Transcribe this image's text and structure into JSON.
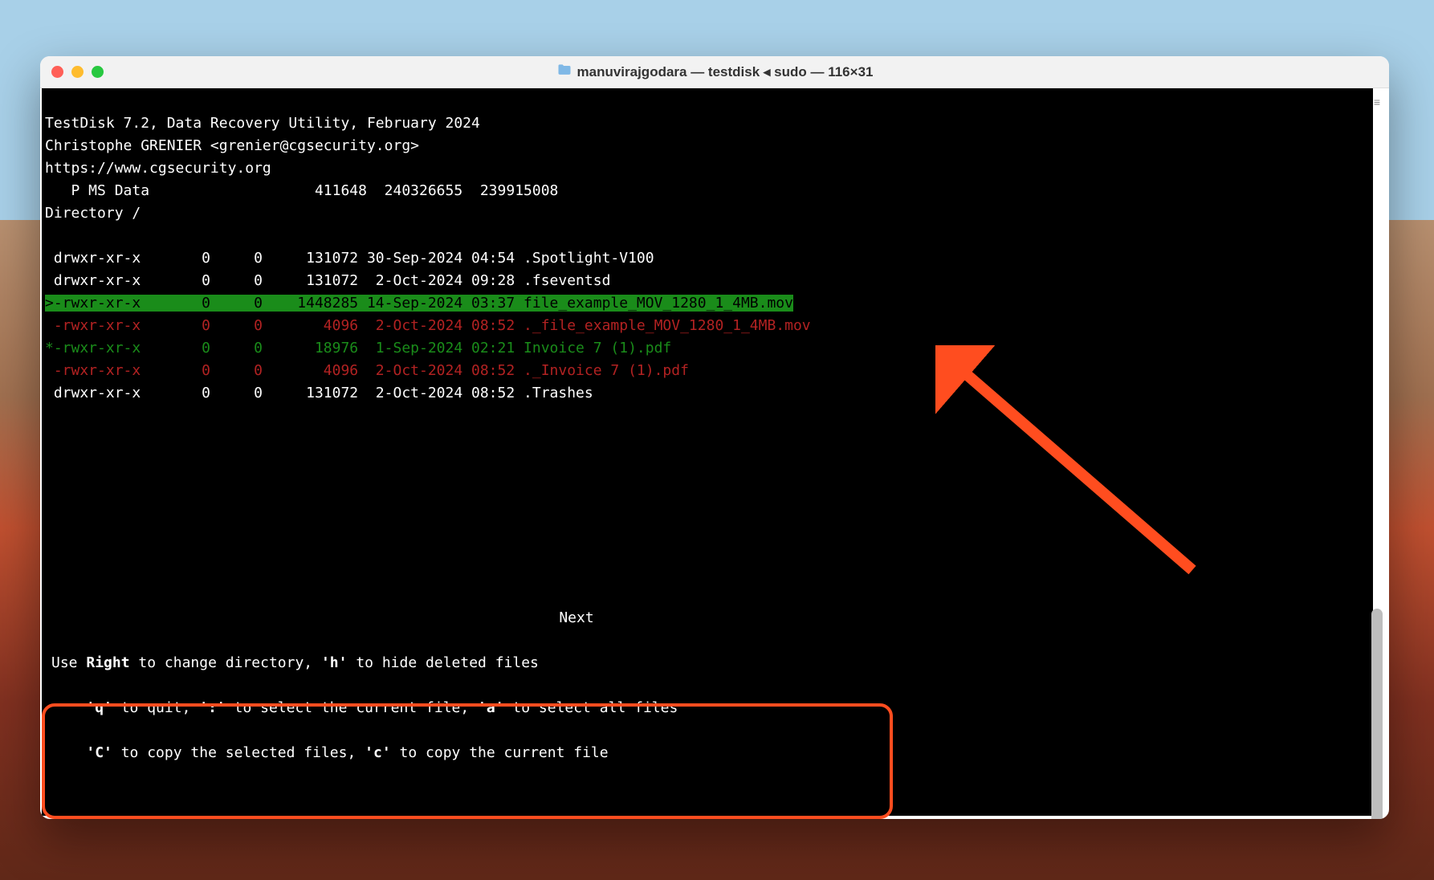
{
  "window": {
    "title": "manuvirajgodara — testdisk ◂ sudo — 116×31"
  },
  "header": {
    "program_line": "TestDisk 7.2, Data Recovery Utility, February 2024",
    "author_line": "Christophe GRENIER <grenier@cgsecurity.org>",
    "url_line": "https://www.cgsecurity.org",
    "partition_line": "   P MS Data                   411648  240326655  239915008",
    "dir_line": "Directory /"
  },
  "rows": [
    {
      "prefix": " ",
      "perm": "drwxr-xr-x",
      "uid": "0",
      "gid": "0",
      "size": "131072",
      "date": "30-Sep-2024",
      "time": "04:54",
      "name": ".Spotlight-V100",
      "style": "white"
    },
    {
      "prefix": " ",
      "perm": "drwxr-xr-x",
      "uid": "0",
      "gid": "0",
      "size": "131072",
      "date": " 2-Oct-2024",
      "time": "09:28",
      "name": ".fseventsd",
      "style": "white"
    },
    {
      "prefix": ">",
      "perm": "-rwxr-xr-x",
      "uid": "0",
      "gid": "0",
      "size": "1448285",
      "date": "14-Sep-2024",
      "time": "03:37",
      "name": "file_example_MOV_1280_1_4MB.mov",
      "style": "selected"
    },
    {
      "prefix": " ",
      "perm": "-rwxr-xr-x",
      "uid": "0",
      "gid": "0",
      "size": "4096",
      "date": " 2-Oct-2024",
      "time": "08:52",
      "name": "._file_example_MOV_1280_1_4MB.mov",
      "style": "red"
    },
    {
      "prefix": "*",
      "perm": "-rwxr-xr-x",
      "uid": "0",
      "gid": "0",
      "size": "18976",
      "date": " 1-Sep-2024",
      "time": "02:21",
      "name": "Invoice 7 (1).pdf",
      "style": "green"
    },
    {
      "prefix": " ",
      "perm": "-rwxr-xr-x",
      "uid": "0",
      "gid": "0",
      "size": "4096",
      "date": " 2-Oct-2024",
      "time": "08:52",
      "name": "._Invoice 7 (1).pdf",
      "style": "red"
    },
    {
      "prefix": " ",
      "perm": "drwxr-xr-x",
      "uid": "0",
      "gid": "0",
      "size": "131072",
      "date": " 2-Oct-2024",
      "time": "08:52",
      "name": ".Trashes",
      "style": "white"
    }
  ],
  "footer": {
    "next": "Next",
    "l1_a": "Use ",
    "l1_b": "Right",
    "l1_c": " to change directory, ",
    "l1_d": "'h'",
    "l1_e": " to hide deleted files",
    "l2_a": "    ",
    "l2_b": "'q'",
    "l2_c": " to quit, ",
    "l2_d": "':'",
    "l2_e": " to select the current file, ",
    "l2_f": "'a'",
    "l2_g": " to select all files",
    "l3_a": "    ",
    "l3_b": "'C'",
    "l3_c": " to copy the selected files, ",
    "l3_d": "'c'",
    "l3_e": " to copy the current file"
  },
  "colors": {
    "selected_bg": "#1a8c1a",
    "deleted_fg": "#b22222",
    "recoverable_fg": "#1a8c1a",
    "annotation": "#ff4d1f"
  }
}
